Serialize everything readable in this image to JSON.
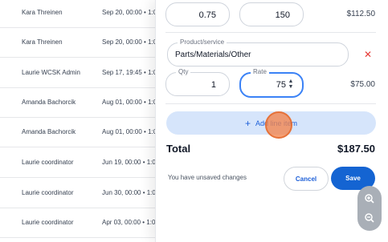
{
  "rows": [
    {
      "name": "Kara Threinen",
      "date": "Sep 20, 00:00 • 1:0"
    },
    {
      "name": "Kara Threinen",
      "date": "Sep 20, 00:00 • 1:0"
    },
    {
      "name": "Laurie WCSK Admin",
      "date": "Sep 17, 19:45 • 1:0"
    },
    {
      "name": "Amanda Bachorcik",
      "date": "Aug 01, 00:00 • 1:0"
    },
    {
      "name": "Amanda Bachorcik",
      "date": "Aug 01, 00:00 • 1:0"
    },
    {
      "name": "Laurie coordinator",
      "date": "Jun 19, 00:00 • 1:0"
    },
    {
      "name": "Laurie coordinator",
      "date": "Jun 30, 00:00 • 1:0"
    },
    {
      "name": "Laurie coordinator",
      "date": "Apr 03, 00:00 • 1:0"
    }
  ],
  "line1": {
    "qty": "0.75",
    "rate": "150",
    "amount": "$112.50"
  },
  "line2": {
    "product_label": "Product/service",
    "product_value": "Parts/Materials/Other",
    "qty_label": "Qty",
    "qty": "1",
    "rate_label": "Rate",
    "rate": "75",
    "amount": "$75.00"
  },
  "add_line_label": "Add line item",
  "total": {
    "label": "Total",
    "value": "$187.50"
  },
  "unsaved_text": "You have unsaved changes",
  "buttons": {
    "cancel": "Cancel",
    "save": "Save"
  },
  "icons": {
    "remove": "close-icon",
    "add": "plus-icon",
    "zoom_in": "zoom-in-icon",
    "zoom_out": "zoom-out-icon"
  },
  "colors": {
    "primary": "#1464d2",
    "add_line_bg": "#d6e5fb",
    "remove": "#e53935",
    "cursor": "#f3844c"
  }
}
